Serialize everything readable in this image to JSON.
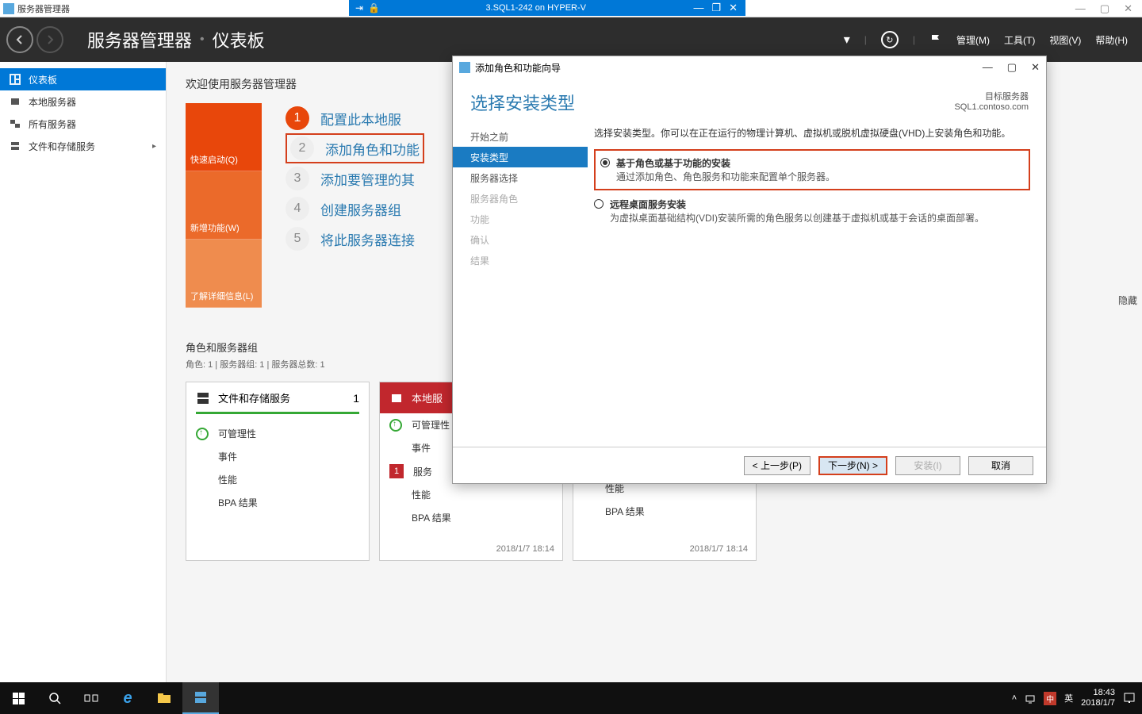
{
  "outer": {
    "title": "服务器管理器"
  },
  "vm": {
    "title": "3.SQL1-242 on HYPER-V"
  },
  "header": {
    "crumb1": "服务器管理器",
    "crumb2": "仪表板",
    "menu": {
      "manage": "管理(M)",
      "tools": "工具(T)",
      "view": "视图(V)",
      "help": "帮助(H)"
    }
  },
  "sidebar": {
    "dashboard": "仪表板",
    "local": "本地服务器",
    "all": "所有服务器",
    "file": "文件和存储服务"
  },
  "welcome": {
    "title": "欢迎使用服务器管理器",
    "tiles": {
      "quick": "快速启动(Q)",
      "whatsnew": "新增功能(W)",
      "learn": "了解详细信息(L)"
    },
    "steps": {
      "s1": "配置此本地服",
      "s2": "添加角色和功能",
      "s3": "添加要管理的其",
      "s4": "创建服务器组",
      "s5": "将此服务器连接"
    }
  },
  "hide": "隐藏",
  "groups": {
    "title": "角色和服务器组",
    "sub": "角色: 1 | 服务器组: 1 | 服务器总数: 1"
  },
  "cards": {
    "file": {
      "title": "文件和存储服务",
      "count": "1"
    },
    "local": {
      "title": "本地服"
    },
    "lines": {
      "manage": "可管理性",
      "events": "事件",
      "services": "服务",
      "perf": "性能",
      "bpa": "BPA 结果",
      "badge1": "1"
    },
    "time": "2018/1/7 18:14"
  },
  "wizard": {
    "title": "添加角色和功能向导",
    "heading": "选择安装类型",
    "target_label": "目标服务器",
    "target_server": "SQL1.contoso.com",
    "nav": {
      "before": "开始之前",
      "type": "安装类型",
      "server": "服务器选择",
      "roles": "服务器角色",
      "features": "功能",
      "confirm": "确认",
      "results": "结果"
    },
    "desc": "选择安装类型。你可以在正在运行的物理计算机、虚拟机或脱机虚拟硬盘(VHD)上安装角色和功能。",
    "opt1_title": "基于角色或基于功能的安装",
    "opt1_sub": "通过添加角色、角色服务和功能来配置单个服务器。",
    "opt2_title": "远程桌面服务安装",
    "opt2_sub": "为虚拟桌面基础结构(VDI)安装所需的角色服务以创建基于虚拟机或基于会话的桌面部署。",
    "buttons": {
      "prev": "< 上一步(P)",
      "next": "下一步(N) >",
      "install": "安装(I)",
      "cancel": "取消"
    }
  },
  "taskbar": {
    "ime1": "中",
    "ime2": "英",
    "time": "18:43",
    "date": "2018/1/7"
  }
}
